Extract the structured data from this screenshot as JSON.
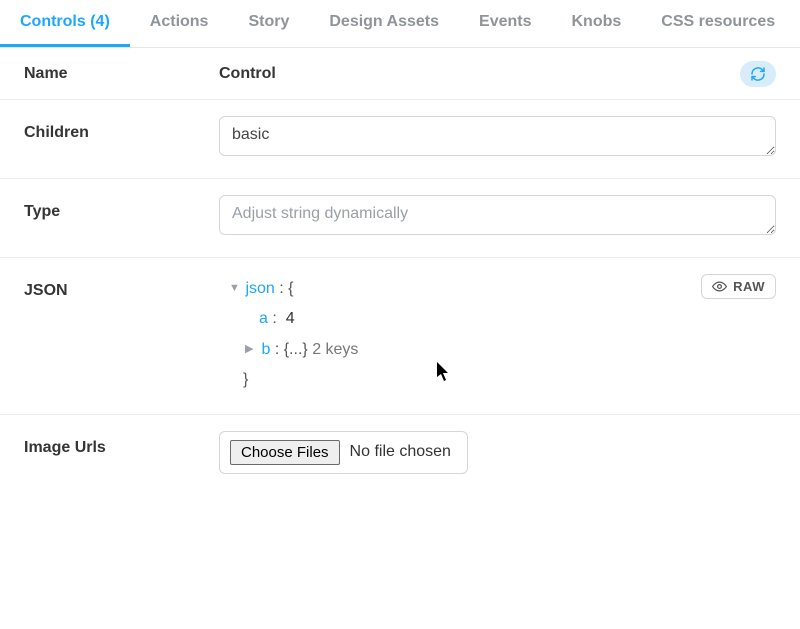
{
  "tabs": [
    {
      "label": "Controls (4)",
      "active": true
    },
    {
      "label": "Actions",
      "active": false
    },
    {
      "label": "Story",
      "active": false
    },
    {
      "label": "Design Assets",
      "active": false
    },
    {
      "label": "Events",
      "active": false
    },
    {
      "label": "Knobs",
      "active": false
    },
    {
      "label": "CSS resources",
      "active": false
    }
  ],
  "header": {
    "name_label": "Name",
    "control_label": "Control"
  },
  "rows": {
    "children": {
      "label": "Children",
      "value": "basic"
    },
    "type": {
      "label": "Type",
      "placeholder": "Adjust string dynamically",
      "value": ""
    },
    "json": {
      "label": "JSON",
      "raw_button": "RAW",
      "tree": {
        "root_key": "json",
        "open_brace": "{",
        "close_brace": "}",
        "a_key": "a",
        "a_val": "4",
        "b_key": "b",
        "b_preview": "{...}",
        "b_meta": "2 keys"
      }
    },
    "image_urls": {
      "label": "Image Urls",
      "button": "Choose Files",
      "status": "No file chosen"
    }
  }
}
